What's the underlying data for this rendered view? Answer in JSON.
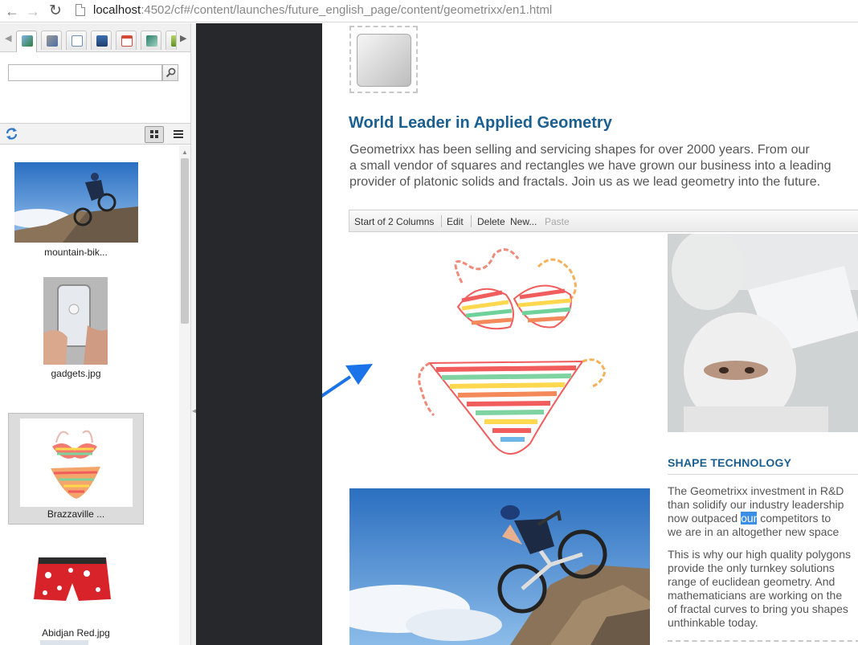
{
  "browser": {
    "url_host": "localhost",
    "url_path": ":4502/cf#/content/launches/future_english_page/content/geometrixx/en1.html"
  },
  "sidekick": {
    "tabs": [
      {
        "icon": "images-icon"
      },
      {
        "icon": "components-icon"
      },
      {
        "icon": "documents-icon"
      },
      {
        "icon": "movies-icon"
      },
      {
        "icon": "calendar-icon"
      },
      {
        "icon": "paragraphs-icon"
      },
      {
        "icon": "products-icon"
      }
    ],
    "search_placeholder": "",
    "assets": [
      {
        "label": "mountain-bik..."
      },
      {
        "label": "gadgets.jpg"
      },
      {
        "label": "Brazzaville ..."
      },
      {
        "label": "Abidjan Red.jpg"
      }
    ]
  },
  "page": {
    "title": "World Leader in Applied Geometry",
    "intro_lines": [
      "Geometrixx has been selling and servicing shapes for over 2000 years. From our",
      "a small vendor of squares and rectangles we have grown our business into a leading",
      "provider of platonic solids and fractals. Join us as we lead geometry into the future."
    ],
    "editbar": {
      "label": "Start of 2 Columns",
      "edit": "Edit",
      "delete": "Delete",
      "new": "New...",
      "paste": "Paste"
    },
    "shape_heading": "SHAPE TECHNOLOGY",
    "para1": {
      "line1": "The Geometrixx investment in R&D",
      "line2": "than solidify our industry leadership",
      "line3_before": "now outpaced ",
      "line3_highlight": "our",
      "line3_after": " competitors to",
      "line4": "we are in an altogether new space"
    },
    "para2_lines": [
      "This is why our high quality polygons",
      "provide the only turnkey solutions",
      "range of euclidean geometry. And",
      "mathematicians are working on the",
      "of fractal curves to bring you shapes",
      "unthinkable today."
    ]
  }
}
